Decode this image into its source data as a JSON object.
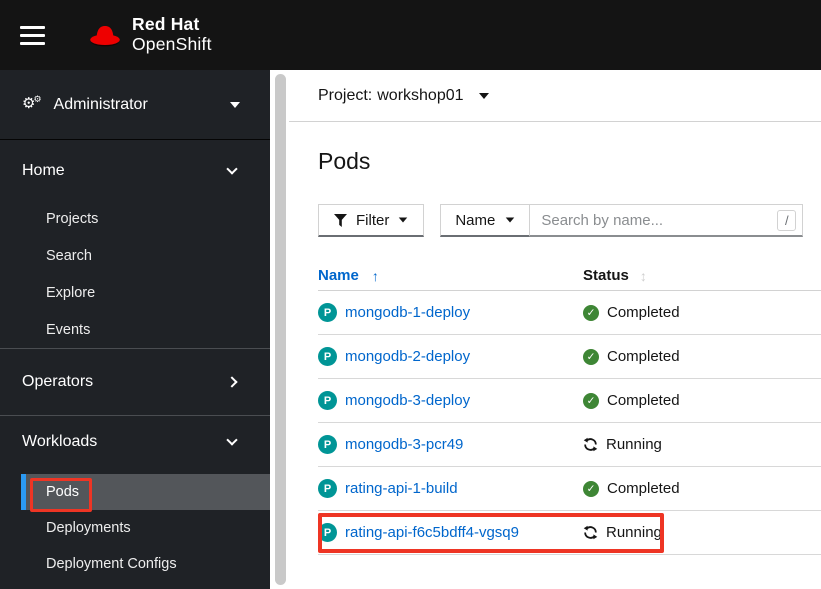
{
  "masthead": {
    "brand_top": "Red Hat",
    "brand_bottom": "OpenShift"
  },
  "sidebar": {
    "perspective": {
      "label": "Administrator"
    },
    "home": {
      "label": "Home",
      "items": [
        "Projects",
        "Search",
        "Explore",
        "Events"
      ]
    },
    "operators": {
      "label": "Operators"
    },
    "workloads": {
      "label": "Workloads",
      "items": [
        "Pods",
        "Deployments",
        "Deployment Configs"
      ],
      "active_item": "Pods"
    }
  },
  "content": {
    "project_selector": {
      "prefix": "Project:",
      "value": "workshop01"
    },
    "title": "Pods",
    "toolbar": {
      "filter_label": "Filter",
      "attribute_label": "Name",
      "search_placeholder": "Search by name...",
      "shortcut_hint": "/"
    },
    "table": {
      "columns": [
        "Name",
        "Status"
      ],
      "rows": [
        {
          "name": "mongodb-1-deploy",
          "status": "Completed"
        },
        {
          "name": "mongodb-2-deploy",
          "status": "Completed"
        },
        {
          "name": "mongodb-3-deploy",
          "status": "Completed"
        },
        {
          "name": "mongodb-3-pcr49",
          "status": "Running"
        },
        {
          "name": "rating-api-1-build",
          "status": "Completed"
        },
        {
          "name": "rating-api-f6c5bdff4-vgsq9",
          "status": "Running"
        }
      ]
    }
  },
  "icons": {
    "pod_badge_letter": "P",
    "check_glyph": "✓",
    "sort_asc_glyph": "↑",
    "sort_both_glyph": "↕",
    "cogs_glyph": "⚙"
  },
  "colors": {
    "masthead_bg": "#141414",
    "sidebar_bg": "#1f2226",
    "active_item_bg": "#53565a",
    "active_item_border": "#2b9af3",
    "link": "#0066cc",
    "pod_badge": "#009596",
    "completed_green": "#3e8635",
    "annotation_red": "#ee3524"
  }
}
